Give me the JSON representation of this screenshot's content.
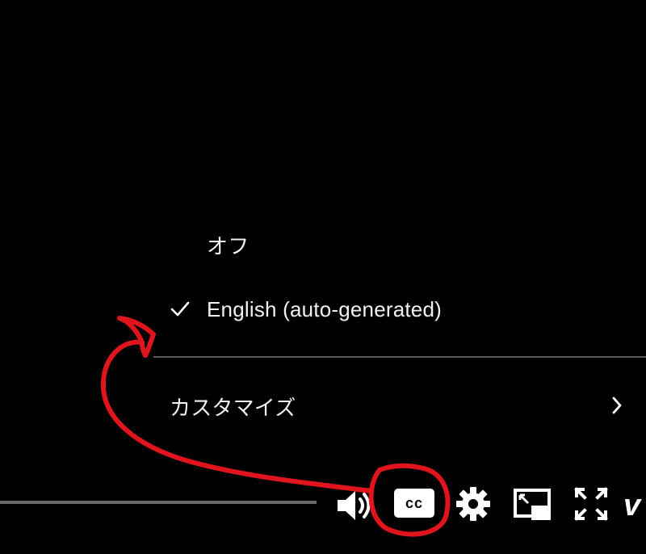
{
  "captions_menu": {
    "items": [
      {
        "label": "オフ",
        "selected": false
      },
      {
        "label": "English (auto-generated)",
        "selected": true
      }
    ],
    "customize_label": "カスタマイズ"
  },
  "controls": {
    "volume_icon": "volume-icon",
    "cc_label": "cc",
    "settings_icon": "gear-icon",
    "miniplayer_icon": "miniplayer-icon",
    "fullscreen_icon": "fullscreen-icon",
    "partial_logo_text": "v"
  },
  "colors": {
    "background": "#000000",
    "text": "#f1f1f1",
    "annotation": "#e0141c"
  }
}
